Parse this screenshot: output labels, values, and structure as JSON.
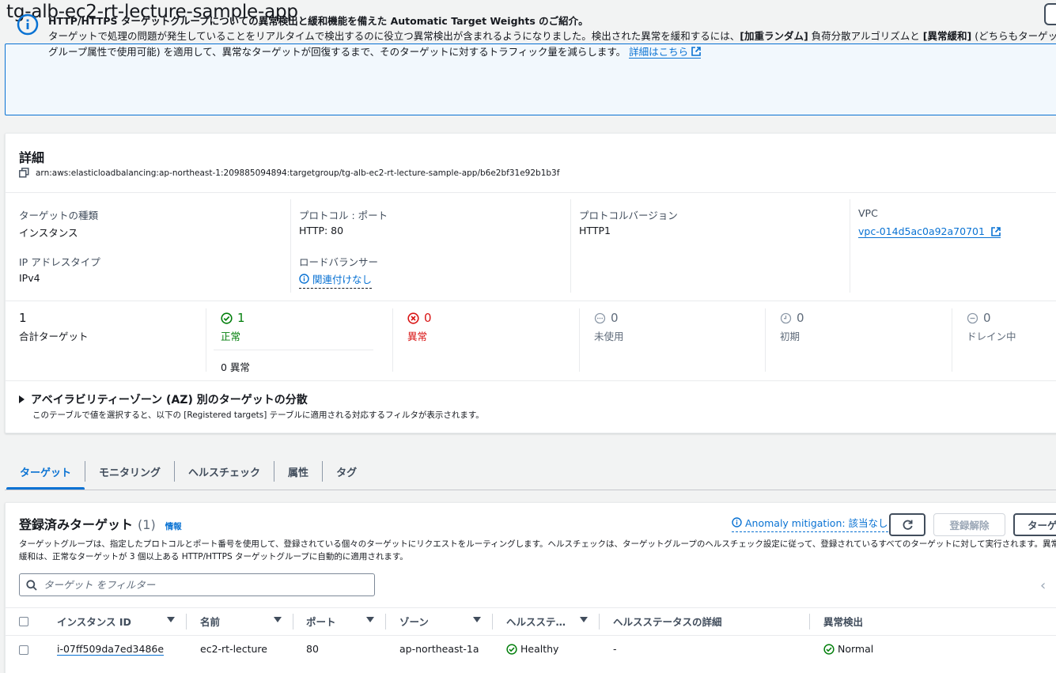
{
  "page": {
    "title": "tg-alb-ec2-rt-lecture-sample-app"
  },
  "banner": {
    "title": "HTTP/HTTPS ターゲットグループについての異常検出と緩和機能を備えた Automatic Target Weights のご紹介。",
    "body_1": "ターゲットで処理の問題が発生していることをリアルタイムで検出するのに役立つ異常検出が含まれるようになりました。検出された異常を緩和するには、",
    "bold_1": "[加重ランダム]",
    "body_2": " 負荷分散アルゴリズムと ",
    "bold_2": "[異常緩和]",
    "body_3": " (どちらもターゲットグループ属性で使用可能) を適用して、異常なターゲットが回復するまで、そのターゲットに対するトラフィック量を減らします。",
    "link": "詳細はこちら"
  },
  "details": {
    "heading": "詳細",
    "arn": "arn:aws:elasticloadbalancing:ap-northeast-1:209885094894:targetgroup/tg-alb-ec2-rt-lecture-sample-app/b6e2bf31e92b1b3f",
    "target_type": {
      "label": "ターゲットの種類",
      "value": "インスタンス"
    },
    "protocol_port": {
      "label": "プロトコル : ポート",
      "value": "HTTP: 80"
    },
    "protocol_version": {
      "label": "プロトコルバージョン",
      "value": "HTTP1"
    },
    "vpc": {
      "label": "VPC",
      "value": "vpc-014d5ac0a92a70701"
    },
    "ip_type": {
      "label": "IP アドレスタイプ",
      "value": "IPv4"
    },
    "load_balancer": {
      "label": "ロードバランサー",
      "value": "関連付けなし"
    }
  },
  "stats": {
    "total": {
      "num": "1",
      "label": "合計ターゲット"
    },
    "healthy": {
      "num": "1",
      "label": "正常",
      "sub": "0 異常"
    },
    "unhealthy": {
      "num": "0",
      "label": "異常"
    },
    "unused": {
      "num": "0",
      "label": "未使用"
    },
    "initial": {
      "num": "0",
      "label": "初期"
    },
    "draining": {
      "num": "0",
      "label": "ドレイン中"
    }
  },
  "az": {
    "title": "アベイラビリティーゾーン (AZ) 別のターゲットの分散",
    "desc": "このテーブルで値を選択すると、以下の [Registered targets] テーブルに適用される対応するフィルタが表示されます。"
  },
  "tabs": [
    "ターゲット",
    "モニタリング",
    "ヘルスチェック",
    "属性",
    "タグ"
  ],
  "targets": {
    "title": "登録済みターゲット",
    "count": "(1)",
    "info": "情報",
    "anomaly": "Anomaly mitigation: 該当なし",
    "deregister": "登録解除",
    "register": "ターゲットを登録",
    "desc": "ターゲットグループは、指定したプロトコルとポート番号を使用して、登録されている個々のターゲットにリクエストをルーティングします。ヘルスチェックは、ターゲットグループのヘルスチェック設定に従って、登録されているすべてのターゲットに対して実行されます。異常緩和は、正常なターゲットが 3 個以上ある HTTP/HTTPS ターゲットグループに自動的に適用されます。",
    "filter_placeholder": "ターゲット をフィルター",
    "columns": [
      "インスタンス ID",
      "名前",
      "ポート",
      "ゾーン",
      "ヘルスステ…",
      "ヘルスステータスの詳細",
      "異常検出"
    ],
    "rows": [
      {
        "instance_id": "i-07ff509da7ed3486e",
        "name": "ec2-rt-lecture",
        "port": "80",
        "zone": "ap-northeast-1a",
        "health": "Healthy",
        "health_detail": "-",
        "anomaly": "Normal"
      }
    ]
  },
  "colors": {
    "accent": "#0972d3",
    "success": "#037f0c",
    "error": "#d91515",
    "muted": "#5f6b7a"
  }
}
